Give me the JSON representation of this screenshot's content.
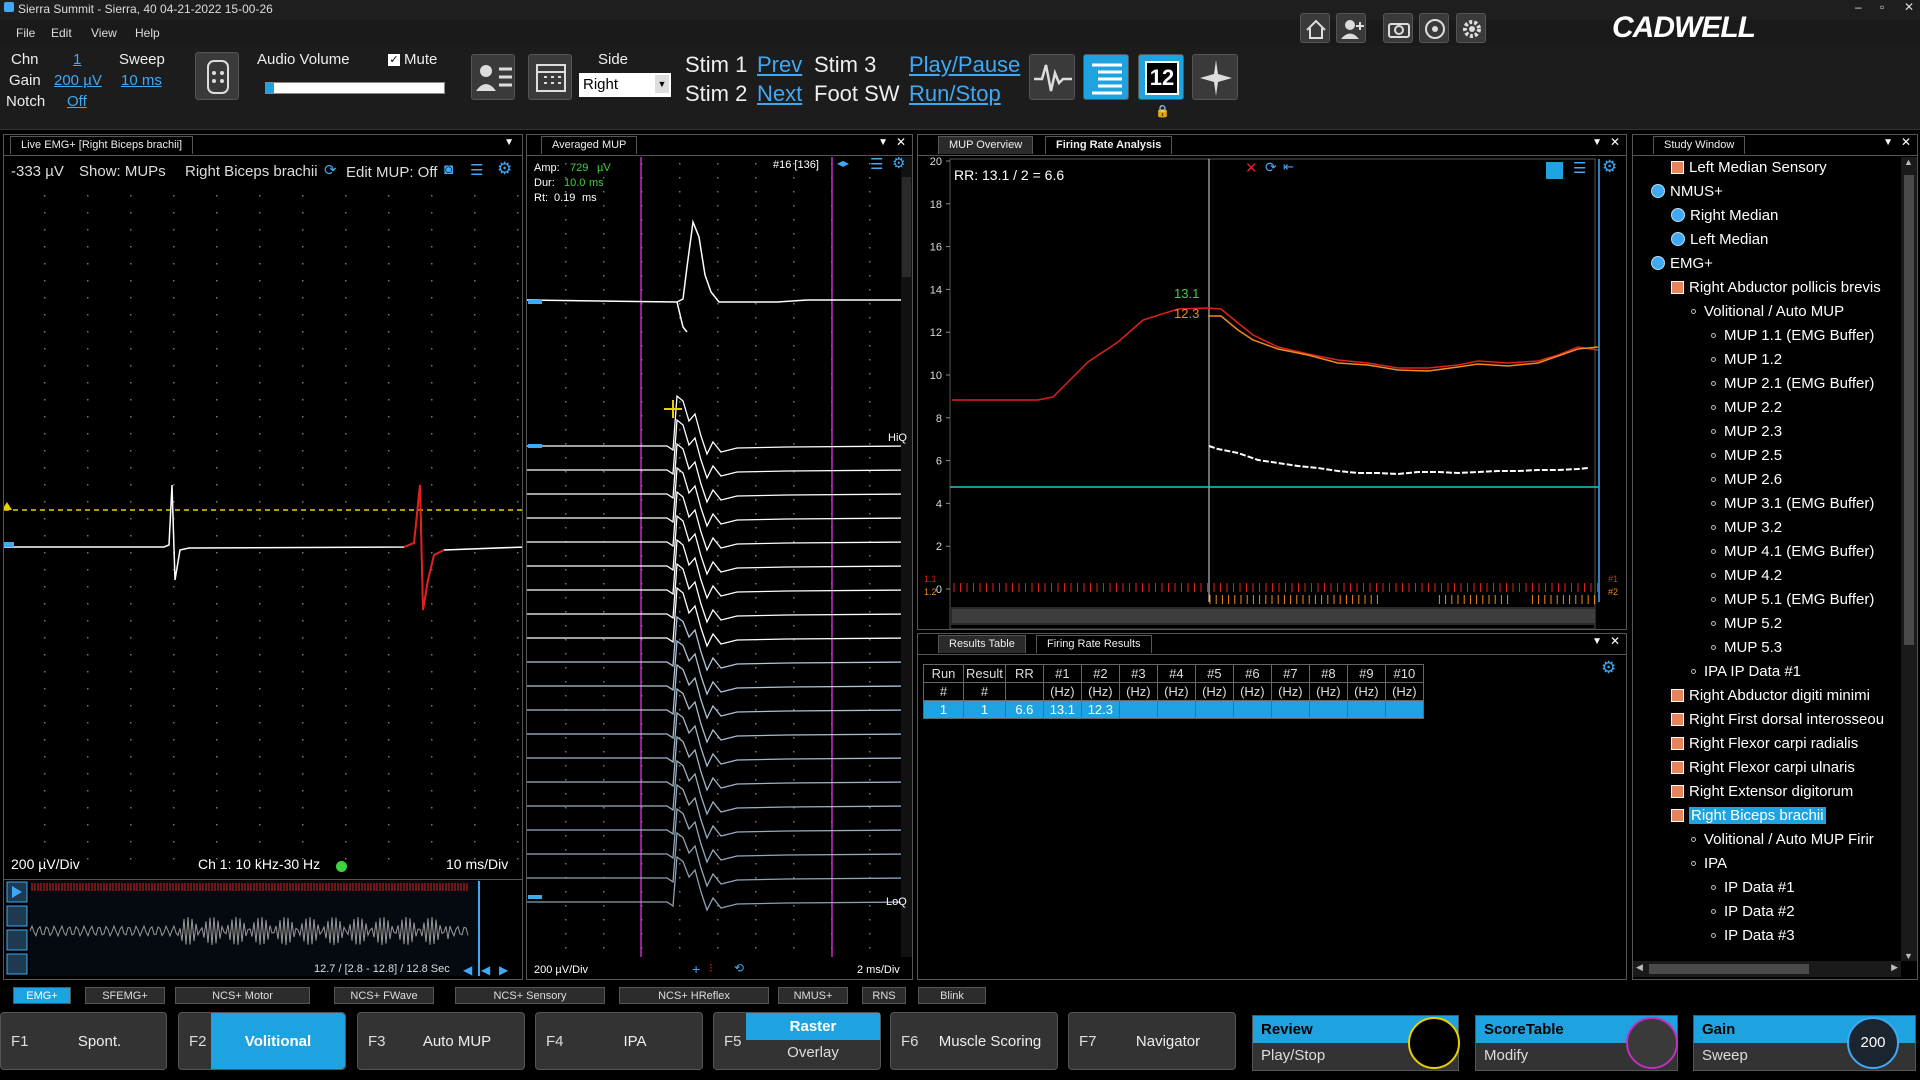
{
  "app": {
    "title": "Sierra Summit - Sierra, 40 04-21-2022 15-00-26",
    "brand": "CADWELL"
  },
  "menu": {
    "file": "File",
    "edit": "Edit",
    "view": "View",
    "help": "Help"
  },
  "toolbar": {
    "chn_label": "Chn",
    "chn_value": "1",
    "gain_label": "Gain",
    "gain_value": "200 µV",
    "notch_label": "Notch",
    "notch_value": "Off",
    "sweep_label": "Sweep",
    "sweep_value": "10 ms",
    "audio_label": "Audio Volume",
    "mute_label": "Mute",
    "side_label": "Side",
    "side_value": "Right",
    "stim1": "Stim 1",
    "stim2": "Stim 2",
    "stim3": "Stim 3",
    "prev": "Prev",
    "next": "Next",
    "foot_sw": "Foot SW",
    "play_pause": "Play/Pause",
    "run_stop": "Run/Stop",
    "counter": "12"
  },
  "live": {
    "tab": "Live EMG+ [Right Biceps brachii]",
    "amp": "-333 µV",
    "show": "Show: MUPs",
    "muscle": "Right Biceps brachii",
    "edit_mup": "Edit MUP: Off",
    "scale": "200 µV/Div",
    "filter": "Ch 1: 10 kHz-30 Hz",
    "time": "10 ms/Div",
    "range": "12.7 / [2.8 - 12.8] / 12.8 Sec"
  },
  "avg": {
    "tab": "Averaged MUP",
    "amp_label": "Amp:",
    "amp_value": "729",
    "amp_unit": "µV",
    "dur_label": "Dur:",
    "dur_value": "10.0",
    "dur_unit": "ms",
    "rt_label": "Rt:",
    "rt_value": "0.19",
    "rt_unit": "ms",
    "index": "#16 [136]",
    "hiq": "HiQ",
    "loq": "LoQ",
    "scale": "200 µV/Div",
    "time": "2 ms/Div"
  },
  "fra": {
    "tab1": "MUP Overview",
    "tab2": "Firing Rate Analysis",
    "rr": "RR: 13.1 / 2 = 6.6",
    "v1": "13.1",
    "v2": "12.3",
    "yticks": [
      "20",
      "18",
      "16",
      "14",
      "12",
      "10",
      "8",
      "6",
      "4",
      "2",
      "0"
    ],
    "r1": "1.1",
    "r2": "1.2",
    "n1": "#1",
    "n2": "#2"
  },
  "results": {
    "tab1": "Results Table",
    "tab2": "Firing Rate Results",
    "headers_top": [
      "Run",
      "Result",
      "RR",
      "#1",
      "#2",
      "#3",
      "#4",
      "#5",
      "#6",
      "#7",
      "#8",
      "#9",
      "#10"
    ],
    "headers_bot": [
      "#",
      "#",
      "",
      "(Hz)",
      "(Hz)",
      "(Hz)",
      "(Hz)",
      "(Hz)",
      "(Hz)",
      "(Hz)",
      "(Hz)",
      "(Hz)",
      "(Hz)"
    ],
    "row": [
      "1",
      "1",
      "6.6",
      "13.1",
      "12.3",
      "",
      "",
      "",
      "",
      "",
      "",
      "",
      ""
    ]
  },
  "study": {
    "tab": "Study Window",
    "items": [
      {
        "t": "Left Median Sensory",
        "lvl": 1,
        "ico": "box"
      },
      {
        "t": "NMUS+",
        "lvl": 0,
        "ico": "globe"
      },
      {
        "t": "Right Median",
        "lvl": 1,
        "ico": "globe"
      },
      {
        "t": "Left Median",
        "lvl": 1,
        "ico": "globe"
      },
      {
        "t": "EMG+",
        "lvl": 0,
        "ico": "globe"
      },
      {
        "t": "Right Abductor pollicis brevis",
        "lvl": 1,
        "ico": "box"
      },
      {
        "t": "Volitional / Auto MUP",
        "lvl": 2,
        "ico": "dot"
      },
      {
        "t": "MUP 1.1 (EMG Buffer)",
        "lvl": 3,
        "ico": "dot"
      },
      {
        "t": "MUP 1.2",
        "lvl": 3,
        "ico": "dot"
      },
      {
        "t": "MUP 2.1 (EMG Buffer)",
        "lvl": 3,
        "ico": "dot"
      },
      {
        "t": "MUP 2.2",
        "lvl": 3,
        "ico": "dot"
      },
      {
        "t": "MUP 2.3",
        "lvl": 3,
        "ico": "dot"
      },
      {
        "t": "MUP 2.5",
        "lvl": 3,
        "ico": "dot"
      },
      {
        "t": "MUP 2.6",
        "lvl": 3,
        "ico": "dot"
      },
      {
        "t": "MUP 3.1 (EMG Buffer)",
        "lvl": 3,
        "ico": "dot"
      },
      {
        "t": "MUP 3.2",
        "lvl": 3,
        "ico": "dot"
      },
      {
        "t": "MUP 4.1 (EMG Buffer)",
        "lvl": 3,
        "ico": "dot"
      },
      {
        "t": "MUP 4.2",
        "lvl": 3,
        "ico": "dot"
      },
      {
        "t": "MUP 5.1 (EMG Buffer)",
        "lvl": 3,
        "ico": "dot"
      },
      {
        "t": "MUP 5.2",
        "lvl": 3,
        "ico": "dot"
      },
      {
        "t": "MUP 5.3",
        "lvl": 3,
        "ico": "dot"
      },
      {
        "t": "IPA IP Data #1",
        "lvl": 2,
        "ico": "dot"
      },
      {
        "t": "Right Abductor digiti minimi",
        "lvl": 1,
        "ico": "box"
      },
      {
        "t": "Right First dorsal interosseou",
        "lvl": 1,
        "ico": "box"
      },
      {
        "t": "Right Flexor carpi radialis",
        "lvl": 1,
        "ico": "box"
      },
      {
        "t": "Right Flexor carpi ulnaris",
        "lvl": 1,
        "ico": "box"
      },
      {
        "t": "Right Extensor digitorum",
        "lvl": 1,
        "ico": "box"
      },
      {
        "t": "Right Biceps brachii",
        "lvl": 1,
        "ico": "box",
        "sel": true
      },
      {
        "t": "Volitional / Auto MUP Firir",
        "lvl": 2,
        "ico": "dot"
      },
      {
        "t": "IPA",
        "lvl": 2,
        "ico": "dot"
      },
      {
        "t": "IP Data #1",
        "lvl": 3,
        "ico": "dot"
      },
      {
        "t": "IP Data #2",
        "lvl": 3,
        "ico": "dot"
      },
      {
        "t": "IP Data #3",
        "lvl": 3,
        "ico": "dot"
      }
    ]
  },
  "modes": [
    "EMG+",
    "SFEMG+",
    "NCS+ Motor",
    "NCS+ FWave",
    "NCS+ Sensory",
    "NCS+ HReflex",
    "NMUS+",
    "RNS",
    "Blink"
  ],
  "fkeys": [
    {
      "n": "F1",
      "l": "Spont."
    },
    {
      "n": "F2",
      "l": "Volitional"
    },
    {
      "n": "F3",
      "l": "Auto MUP"
    },
    {
      "n": "F4",
      "l": "IPA"
    },
    {
      "n": "F5",
      "l": "Raster",
      "l2": "Overlay"
    },
    {
      "n": "F6",
      "l": "Muscle Scoring"
    },
    {
      "n": "F7",
      "l": "Navigator"
    }
  ],
  "toggles": {
    "review": "Review",
    "playstop": "Play/Stop",
    "scoretable": "ScoreTable",
    "modify": "Modify",
    "gain": "Gain",
    "sweep": "Sweep",
    "gain_value": "200"
  },
  "colors": {
    "accent": "#1fa3e0",
    "link": "#3fa9f5",
    "trace_red": "#e0201e",
    "trace_orange": "#f08a1c",
    "marker_magenta": "#c02fc4",
    "value_green": "#3fd23f"
  }
}
